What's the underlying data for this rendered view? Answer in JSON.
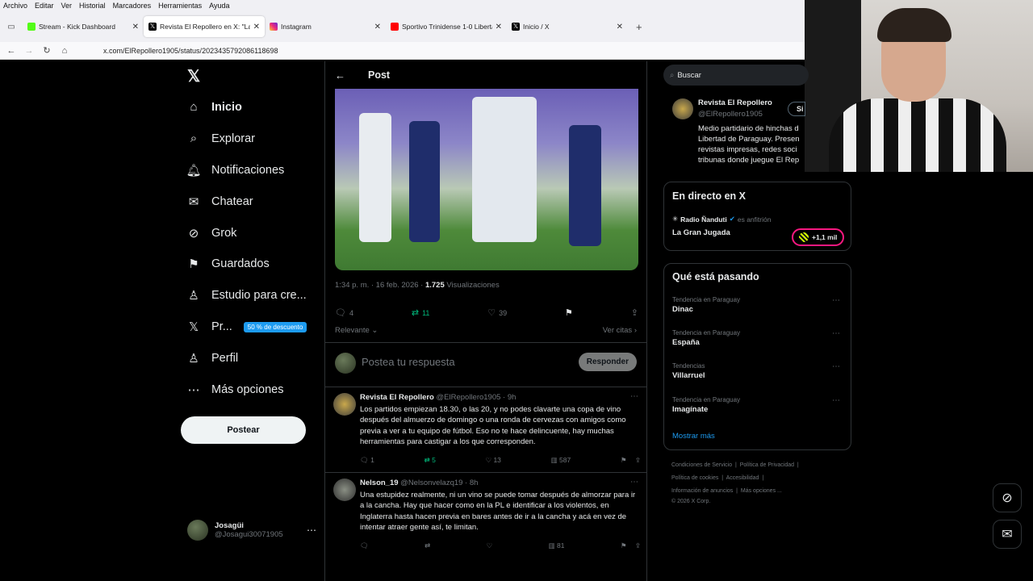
{
  "browser": {
    "menu": [
      "Archivo",
      "Editar",
      "Ver",
      "Historial",
      "Marcadores",
      "Herramientas",
      "Ayuda"
    ],
    "tabs": [
      {
        "title": "Stream - Kick Dashboard",
        "active": false
      },
      {
        "title": "Revista El Repollero en X: \"La b",
        "active": true
      },
      {
        "title": "Instagram",
        "active": false
      },
      {
        "title": "Sportivo Trinidense 1-0 Libertad",
        "active": false
      },
      {
        "title": "Inicio / X",
        "active": false
      }
    ],
    "url": "x.com/ElRepollero1905/status/2023435792086118698"
  },
  "sidebar": {
    "logo": "X",
    "items": [
      {
        "label": "Inicio",
        "icon": "home-icon"
      },
      {
        "label": "Explorar",
        "icon": "search-icon"
      },
      {
        "label": "Notificaciones",
        "icon": "bell-icon"
      },
      {
        "label": "Chatear",
        "icon": "mail-icon"
      },
      {
        "label": "Grok",
        "icon": "grok-icon"
      },
      {
        "label": "Guardados",
        "icon": "bookmark-icon"
      },
      {
        "label": "Estudio para cre...",
        "icon": "creator-icon"
      },
      {
        "label": "Pr...",
        "icon": "x-premium-icon",
        "badge": "50 % de descuento"
      },
      {
        "label": "Perfil",
        "icon": "person-icon"
      },
      {
        "label": "Más opciones",
        "icon": "more-circle-icon"
      }
    ],
    "post_button": "Postear",
    "user": {
      "name": "Josagüi",
      "handle": "@Josagui30071905"
    }
  },
  "main": {
    "header_title": "Post",
    "meta": {
      "time": "1:34 p. m. · 16 feb. 2026 · ",
      "views": "1.725",
      "views_label": " Visualizaciones"
    },
    "actions": {
      "replies": "4",
      "reposts": "11",
      "likes": "39"
    },
    "relevance": "Relevante",
    "see_quotes": "Ver citas",
    "reply_placeholder": "Postea tu respuesta",
    "reply_button": "Responder",
    "replies": [
      {
        "name": "Revista El Repollero",
        "handle": "@ElRepollero1905 · 9h",
        "text": "Los partidos empiezan 18.30, o las 20, y no podes clavarte una copa de vino después del almuerzo de domingo o una ronda de cervezas con amigos como previa a ver a tu equipo de fútbol. Eso no te hace delincuente, hay muchas herramientas para castigar a los que corresponden.",
        "replies": "1",
        "reposts": "5",
        "likes": "13",
        "views": "587"
      },
      {
        "name": "Nelson_19",
        "handle": "@Nelsonvelazq19 · 8h",
        "text": "Una estupidez realmente, ni un vino se puede tomar después de almorzar para ir a la cancha. Hay que hacer como en la PL e identificar a los violentos, en Inglaterra hasta hacen previa en bares antes de ir a la cancha y acá en vez de intentar atraer gente así, te limitan.",
        "replies": "",
        "reposts": "",
        "likes": "",
        "views": "81"
      }
    ]
  },
  "right": {
    "search_placeholder": "Buscar",
    "profile": {
      "name": "Revista El Repollero",
      "handle": "@ElRepollero1905",
      "follow": "Si",
      "bio_lines": [
        "Medio partidario de hinchas d",
        "Libertad de Paraguay. Presen",
        "revistas impresas, redes soci",
        "tribunas donde juegue El Rep"
      ]
    },
    "live": {
      "title": "En directo en X",
      "host": "Radio Ñanduti",
      "host_suffix": "es anfitrión",
      "show": "La Gran Jugada",
      "listeners": "+1,1 mil"
    },
    "trends": {
      "title": "Qué está pasando",
      "items": [
        {
          "category": "Tendencia en Paraguay",
          "topic": "Dinac"
        },
        {
          "category": "Tendencia en Paraguay",
          "topic": "España"
        },
        {
          "category": "Tendencias",
          "topic": "Villarruel"
        },
        {
          "category": "Tendencia en Paraguay",
          "topic": "Imagínate"
        }
      ],
      "show_more": "Mostrar más"
    },
    "footer": {
      "links1": [
        "Condiciones de Servicio",
        "Política de Privacidad"
      ],
      "links2": [
        "Política de cookies",
        "Accesibilidad"
      ],
      "links3": [
        "Información de anuncios",
        "Más opciones ..."
      ],
      "copyright": "© 2026 X Corp."
    }
  },
  "colors": {
    "accent": "#1d9bf0",
    "background": "#000000",
    "text": "#e7e9ea",
    "muted": "#71767b",
    "repost_green": "#00ba7c",
    "live_pink": "#f91880"
  }
}
